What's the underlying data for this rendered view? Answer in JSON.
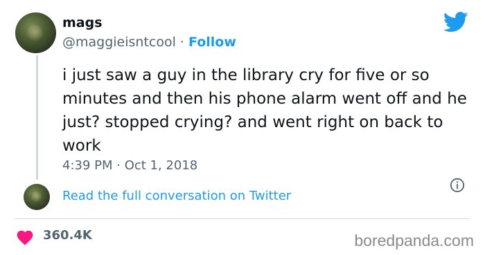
{
  "tweet": {
    "author_name": "mags",
    "handle": "@maggieisntcool",
    "separator": " · ",
    "follow_label": "Follow",
    "text": "i just saw a guy in the library cry for five or so minutes and then his phone alarm went off and he just? stopped crying? and went right on back to work",
    "timestamp": "4:39 PM · Oct 1, 2018",
    "read_more_label": "Read the full conversation on Twitter",
    "likes_count": "360.4K"
  },
  "watermark": "boredpanda.com",
  "colors": {
    "accent": "#1d9bf0",
    "heart": "#f91880",
    "muted_text": "#536471",
    "divider": "#cfd9de"
  },
  "icons": {
    "brand": "twitter-bird-icon",
    "info": "info-icon",
    "like": "heart-icon"
  }
}
